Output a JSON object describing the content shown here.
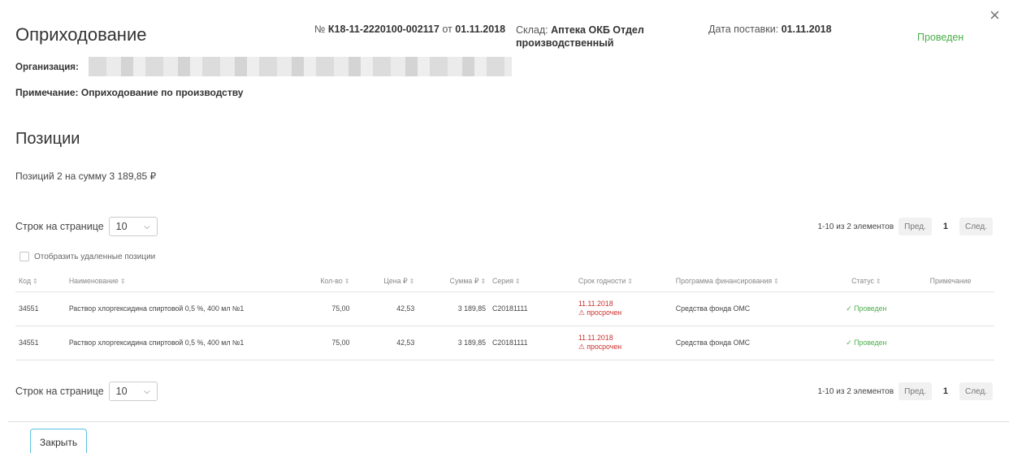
{
  "header": {
    "title": "Оприходование",
    "doc_prefix": "№",
    "doc_number": "К18-11-2220100-002117",
    "doc_from": "от",
    "doc_date": "01.11.2018",
    "warehouse_label": "Склад:",
    "warehouse_value": "Аптека ОКБ Отдел производственный",
    "delivery_label": "Дата поставки:",
    "delivery_value": "01.11.2018",
    "status": "Проведен",
    "close_icon": "×"
  },
  "organization_label": "Организация:",
  "note": "Примечание: Оприходование по производству",
  "positions": {
    "title": "Позиции",
    "summary": "Позиций 2 на сумму 3 189,85 ₽"
  },
  "pagination": {
    "rows_label": "Строк на странице",
    "rows_value": "10",
    "range": "1-10 из 2 элементов",
    "prev": "Пред.",
    "page": "1",
    "next": "След."
  },
  "show_deleted_label": "Отобразить удаленные позиции",
  "table": {
    "columns": [
      "Код",
      "Наименование",
      "Кол-во",
      "Цена ₽",
      "Сумма ₽",
      "Серия",
      "Срок годности",
      "Программа финансирования",
      "Статус",
      "Примечание"
    ],
    "rows": [
      {
        "code": "34551",
        "name": "Раствор хлоргексидина спиртовой 0,5 %, 400 мл №1",
        "qty": "75,00",
        "price": "42,53",
        "sum": "3 189,85",
        "series": "C20181111",
        "expiry": "11.11.2018",
        "expiry_warn": "просрочен",
        "program": "Средства фонда ОМС",
        "status": "Проведен",
        "note": ""
      },
      {
        "code": "34551",
        "name": "Раствор хлоргексидина спиртовой 0,5 %, 400 мл №1",
        "qty": "75,00",
        "price": "42,53",
        "sum": "3 189,85",
        "series": "C20181111",
        "expiry": "11.11.2018",
        "expiry_warn": "просрочен",
        "program": "Средства фонда ОМС",
        "status": "Проведен",
        "note": ""
      }
    ]
  },
  "footer": {
    "close_button": "Закрыть"
  },
  "colors": {
    "accent": "#5bc0de",
    "success": "#4cae4c",
    "danger": "#c9302c"
  }
}
